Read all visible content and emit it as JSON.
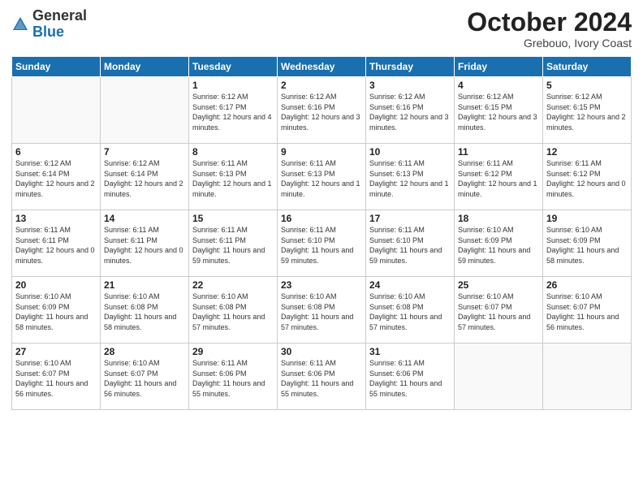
{
  "header": {
    "logo_general": "General",
    "logo_blue": "Blue",
    "month_title": "October 2024",
    "subtitle": "Grebouo, Ivory Coast"
  },
  "weekdays": [
    "Sunday",
    "Monday",
    "Tuesday",
    "Wednesday",
    "Thursday",
    "Friday",
    "Saturday"
  ],
  "weeks": [
    [
      {
        "day": "",
        "info": ""
      },
      {
        "day": "",
        "info": ""
      },
      {
        "day": "1",
        "info": "Sunrise: 6:12 AM\nSunset: 6:17 PM\nDaylight: 12 hours and 4 minutes."
      },
      {
        "day": "2",
        "info": "Sunrise: 6:12 AM\nSunset: 6:16 PM\nDaylight: 12 hours and 3 minutes."
      },
      {
        "day": "3",
        "info": "Sunrise: 6:12 AM\nSunset: 6:16 PM\nDaylight: 12 hours and 3 minutes."
      },
      {
        "day": "4",
        "info": "Sunrise: 6:12 AM\nSunset: 6:15 PM\nDaylight: 12 hours and 3 minutes."
      },
      {
        "day": "5",
        "info": "Sunrise: 6:12 AM\nSunset: 6:15 PM\nDaylight: 12 hours and 2 minutes."
      }
    ],
    [
      {
        "day": "6",
        "info": "Sunrise: 6:12 AM\nSunset: 6:14 PM\nDaylight: 12 hours and 2 minutes."
      },
      {
        "day": "7",
        "info": "Sunrise: 6:12 AM\nSunset: 6:14 PM\nDaylight: 12 hours and 2 minutes."
      },
      {
        "day": "8",
        "info": "Sunrise: 6:11 AM\nSunset: 6:13 PM\nDaylight: 12 hours and 1 minute."
      },
      {
        "day": "9",
        "info": "Sunrise: 6:11 AM\nSunset: 6:13 PM\nDaylight: 12 hours and 1 minute."
      },
      {
        "day": "10",
        "info": "Sunrise: 6:11 AM\nSunset: 6:13 PM\nDaylight: 12 hours and 1 minute."
      },
      {
        "day": "11",
        "info": "Sunrise: 6:11 AM\nSunset: 6:12 PM\nDaylight: 12 hours and 1 minute."
      },
      {
        "day": "12",
        "info": "Sunrise: 6:11 AM\nSunset: 6:12 PM\nDaylight: 12 hours and 0 minutes."
      }
    ],
    [
      {
        "day": "13",
        "info": "Sunrise: 6:11 AM\nSunset: 6:11 PM\nDaylight: 12 hours and 0 minutes."
      },
      {
        "day": "14",
        "info": "Sunrise: 6:11 AM\nSunset: 6:11 PM\nDaylight: 12 hours and 0 minutes."
      },
      {
        "day": "15",
        "info": "Sunrise: 6:11 AM\nSunset: 6:11 PM\nDaylight: 11 hours and 59 minutes."
      },
      {
        "day": "16",
        "info": "Sunrise: 6:11 AM\nSunset: 6:10 PM\nDaylight: 11 hours and 59 minutes."
      },
      {
        "day": "17",
        "info": "Sunrise: 6:11 AM\nSunset: 6:10 PM\nDaylight: 11 hours and 59 minutes."
      },
      {
        "day": "18",
        "info": "Sunrise: 6:10 AM\nSunset: 6:09 PM\nDaylight: 11 hours and 59 minutes."
      },
      {
        "day": "19",
        "info": "Sunrise: 6:10 AM\nSunset: 6:09 PM\nDaylight: 11 hours and 58 minutes."
      }
    ],
    [
      {
        "day": "20",
        "info": "Sunrise: 6:10 AM\nSunset: 6:09 PM\nDaylight: 11 hours and 58 minutes."
      },
      {
        "day": "21",
        "info": "Sunrise: 6:10 AM\nSunset: 6:08 PM\nDaylight: 11 hours and 58 minutes."
      },
      {
        "day": "22",
        "info": "Sunrise: 6:10 AM\nSunset: 6:08 PM\nDaylight: 11 hours and 57 minutes."
      },
      {
        "day": "23",
        "info": "Sunrise: 6:10 AM\nSunset: 6:08 PM\nDaylight: 11 hours and 57 minutes."
      },
      {
        "day": "24",
        "info": "Sunrise: 6:10 AM\nSunset: 6:08 PM\nDaylight: 11 hours and 57 minutes."
      },
      {
        "day": "25",
        "info": "Sunrise: 6:10 AM\nSunset: 6:07 PM\nDaylight: 11 hours and 57 minutes."
      },
      {
        "day": "26",
        "info": "Sunrise: 6:10 AM\nSunset: 6:07 PM\nDaylight: 11 hours and 56 minutes."
      }
    ],
    [
      {
        "day": "27",
        "info": "Sunrise: 6:10 AM\nSunset: 6:07 PM\nDaylight: 11 hours and 56 minutes."
      },
      {
        "day": "28",
        "info": "Sunrise: 6:10 AM\nSunset: 6:07 PM\nDaylight: 11 hours and 56 minutes."
      },
      {
        "day": "29",
        "info": "Sunrise: 6:11 AM\nSunset: 6:06 PM\nDaylight: 11 hours and 55 minutes."
      },
      {
        "day": "30",
        "info": "Sunrise: 6:11 AM\nSunset: 6:06 PM\nDaylight: 11 hours and 55 minutes."
      },
      {
        "day": "31",
        "info": "Sunrise: 6:11 AM\nSunset: 6:06 PM\nDaylight: 11 hours and 55 minutes."
      },
      {
        "day": "",
        "info": ""
      },
      {
        "day": "",
        "info": ""
      }
    ]
  ]
}
